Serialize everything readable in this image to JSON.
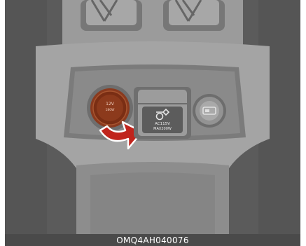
{
  "figure": {
    "code": "OMQ4AH040076"
  },
  "socket_12v": {
    "label_line1": "12V",
    "label_line2": "180W"
  },
  "inverter_outlet": {
    "label_line1": "AC115V",
    "label_line2": "MAX200W"
  },
  "colors": {
    "background": "#5d5d5d",
    "console": "#a9a9a9",
    "socket_accent": "#7a2e14",
    "arrow_red": "#c0241c",
    "caption_bar": "#4a4a4a"
  }
}
